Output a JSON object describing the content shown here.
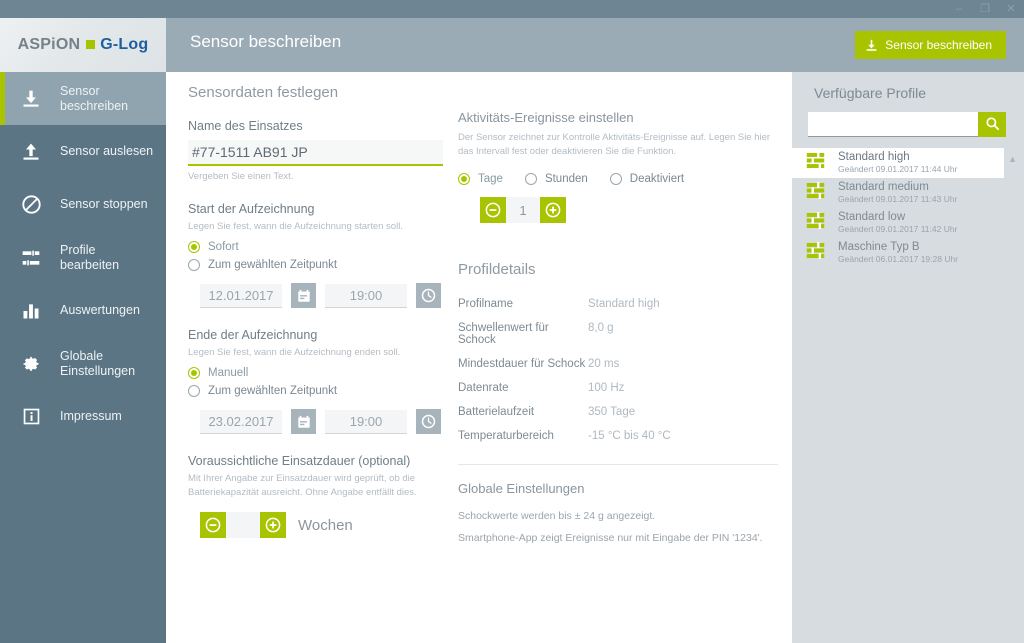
{
  "window": {
    "minimize": "–",
    "maximize": "❐",
    "close": "✕"
  },
  "header": {
    "logo_aspion": "ASPiON",
    "logo_glog": "G-Log",
    "title": "Sensor beschreiben",
    "action_button": "Sensor beschreiben",
    "accent_green": "#a8c400",
    "header_bg": "#9aabb5"
  },
  "sidebar": {
    "bg": "#5b7585",
    "items": [
      {
        "label": "Sensor\nbeschreiben",
        "icon": "download-icon",
        "active": true
      },
      {
        "label": "Sensor auslesen",
        "icon": "upload-icon",
        "active": false
      },
      {
        "label": "Sensor stoppen",
        "icon": "stop-icon",
        "active": false
      },
      {
        "label": "Profile\nbearbeiten",
        "icon": "sliders-icon",
        "active": false
      },
      {
        "label": "Auswertungen",
        "icon": "bar-chart-icon",
        "active": false
      },
      {
        "label": "Globale\nEinstellungen",
        "icon": "gear-icon",
        "active": false
      },
      {
        "label": "Impressum",
        "icon": "info-icon",
        "active": false
      }
    ]
  },
  "main": {
    "section_title": "Sensordaten festlegen",
    "name_field": {
      "label": "Name des Einsatzes",
      "value": "#77-1511 AB91 JP",
      "placeholder": "",
      "hint": "Vergeben Sie einen Text."
    },
    "start_recording": {
      "title": "Start der Aufzeichnung",
      "hint": "Legen Sie fest, wann die Aufzeichnung starten soll.",
      "options": [
        {
          "label": "Sofort",
          "selected": true
        },
        {
          "label": "Zum gewählten Zeitpunkt",
          "selected": false
        }
      ],
      "date": "12.01.2017",
      "time": "19:00"
    },
    "end_recording": {
      "title": "Ende der Aufzeichnung",
      "hint": "Legen Sie fest, wann die Aufzeichnung enden soll.",
      "options": [
        {
          "label": "Manuell",
          "selected": true
        },
        {
          "label": "Zum gewählten Zeitpunkt",
          "selected": false
        }
      ],
      "date": "23.02.2017",
      "time": "19:00"
    },
    "duration": {
      "title": "Voraussichtliche Einsatzdauer (optional)",
      "hint": "Mit Ihrer Angabe zur Einsatzdauer wird geprüft, ob die Batteriekapazität ausreicht. Ohne Angabe entfällt dies.",
      "value": "",
      "unit": "Wochen",
      "minus": "−",
      "plus": "+"
    }
  },
  "activity": {
    "title": "Aktivitäts-Ereignisse einstellen",
    "hint": "Der Sensor zeichnet zur Kontrolle Aktivitäts-Ereignisse auf. Legen Sie hier das Intervall fest oder deaktivieren Sie die Funktion.",
    "options": [
      {
        "label": "Tage",
        "selected": true
      },
      {
        "label": "Stunden",
        "selected": false
      },
      {
        "label": "Deaktiviert",
        "selected": false
      }
    ],
    "value": "1"
  },
  "profile_details": {
    "title": "Profildetails",
    "rows": [
      {
        "key": "Profilname",
        "value": "Standard high"
      },
      {
        "key": "Schwellenwert für Schock",
        "value": "8,0 g"
      },
      {
        "key": "Mindestdauer für Schock",
        "value": "20 ms"
      },
      {
        "key": "Datenrate",
        "value": "100 Hz"
      },
      {
        "key": "Batterielaufzeit",
        "value": "350 Tage"
      },
      {
        "key": "Temperaturbereich",
        "value": "-15 °C  bis  40 °C"
      }
    ]
  },
  "global_settings": {
    "title": "Globale Einstellungen",
    "lines": [
      "Schockwerte werden bis ± 24 g angezeigt.",
      "Smartphone-App zeigt Ereignisse nur mit Eingabe der PIN '1234'."
    ]
  },
  "profiles_panel": {
    "title": "Verfügbare Profile",
    "search_value": "",
    "search_placeholder": "",
    "items": [
      {
        "name": "Standard high",
        "modified": "Geändert 09.01.2017 11:44 Uhr",
        "selected": true
      },
      {
        "name": "Standard medium",
        "modified": "Geändert 09.01.2017 11:43 Uhr",
        "selected": false
      },
      {
        "name": "Standard low",
        "modified": "Geändert 09.01.2017 11:42 Uhr",
        "selected": false
      },
      {
        "name": "Maschine Typ B",
        "modified": "Geändert 06.01.2017 19:28 Uhr",
        "selected": false
      }
    ]
  }
}
